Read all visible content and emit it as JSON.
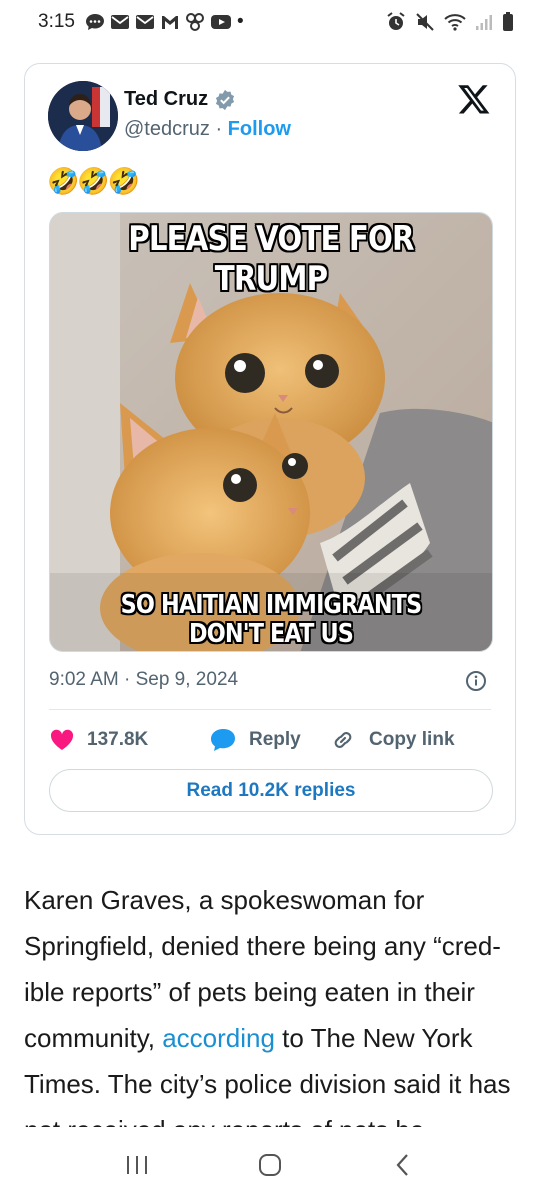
{
  "status_bar": {
    "time": "3:15",
    "left_icons": [
      "chat-icon",
      "mail-icon",
      "mail-icon",
      "gmail-icon",
      "pinwheel-icon",
      "youtube-icon",
      "dot-icon"
    ],
    "right_icons": [
      "alarm-icon",
      "mute-icon",
      "wifi-icon",
      "signal-icon",
      "battery-icon"
    ],
    "dot": "•"
  },
  "tweet": {
    "author_name": "Ted Cruz",
    "handle": "@tedcruz",
    "separator": " · ",
    "follow_label": "Follow",
    "emojis": "🤣🤣🤣",
    "meme_top_text": "PLEASE VOTE FOR TRUMP",
    "meme_bottom_text": "SO HAITIAN IMMIGRANTS DON'T EAT US",
    "timestamp": "9:02 AM · Sep 9, 2024",
    "likes_count": "137.8K",
    "reply_label": "Reply",
    "copy_link_label": "Copy link",
    "read_replies_label": "Read 10.2K replies",
    "colors": {
      "like": "#f91880",
      "reply": "#1d9bf0",
      "link": "#1d78c1"
    }
  },
  "article": {
    "text_before_link": "Karen Graves, a spokeswoman for Springfield, denied there being any “cred-ible reports” of pets being eaten in their community, ",
    "link_text": "according",
    "text_after_link": " to The New York Times. The city’s police division said it has not received any reports of pets be-"
  },
  "nav_bar": {
    "buttons": [
      "recents-icon",
      "home-icon",
      "back-icon"
    ]
  }
}
